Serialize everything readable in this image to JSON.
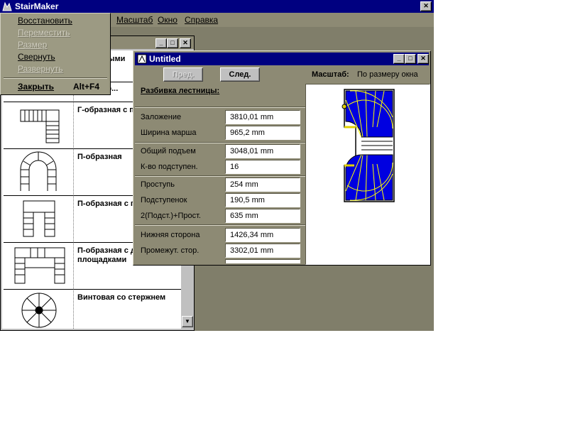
{
  "app": {
    "title": "StairMaker",
    "menu": [
      "Масштаб",
      "Окно",
      "Справка"
    ]
  },
  "system_menu": {
    "items": [
      {
        "label": "Восстановить",
        "enabled": true
      },
      {
        "label": "Переместить",
        "enabled": false
      },
      {
        "label": "Размер",
        "enabled": false
      },
      {
        "label": "Свернуть",
        "enabled": true
      },
      {
        "label": "Развернуть",
        "enabled": false
      }
    ],
    "close_label": "Закрыть",
    "close_shortcut": "Alt+F4"
  },
  "stair_list": {
    "items": [
      {
        "label": "...ая с ...ыми"
      },
      {
        "label": "...вейвер..."
      },
      {
        "label": "Г-образная с площадкой"
      },
      {
        "label": "П-образная"
      },
      {
        "label": "П-образная с площадкой"
      },
      {
        "label": "П-образная с д... площадками"
      },
      {
        "label": "Винтовая со стержнем"
      }
    ]
  },
  "doc_window": {
    "title": "Untitled",
    "prev_label": "Пред.",
    "next_label": "След.",
    "scale_label": "Масштаб:",
    "scale_value": "По размеру окна",
    "section_title": "Разбивка лестницы:",
    "fields": [
      {
        "label": "Заложение",
        "value": "3810,01 mm"
      },
      {
        "label": "Ширина марша",
        "value": "965,2 mm"
      },
      {
        "label": "Общий подъем",
        "value": "3048,01 mm"
      },
      {
        "label": "К-во подступен.",
        "value": "16"
      },
      {
        "label": "Проступь",
        "value": "254 mm"
      },
      {
        "label": "Подступенок",
        "value": "190,5 mm"
      },
      {
        "label": "2(Подст.)+Прост.",
        "value": "635 mm"
      },
      {
        "label": "Нижняя сторона",
        "value": "1426,34 mm"
      },
      {
        "label": "Промежут. стор.",
        "value": "3302,01 mm"
      }
    ]
  },
  "colors": {
    "desktop": "#807e6a",
    "titlebar": "#000080",
    "stair_fill": "#0000e0"
  }
}
